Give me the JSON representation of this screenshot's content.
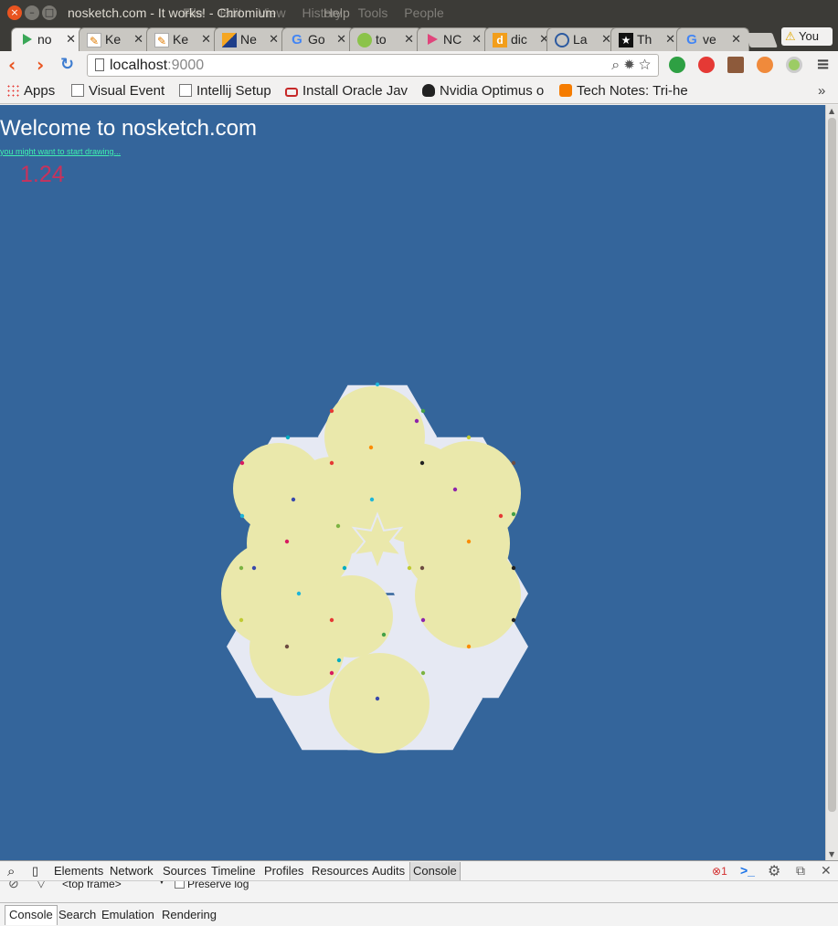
{
  "window": {
    "title": "nosketch.com - It works! - Chromium",
    "menus": [
      "File",
      "Edit",
      "View",
      "History",
      "Tools",
      "People"
    ],
    "help_menu": "Help"
  },
  "tabs": [
    {
      "label": "no",
      "icon": "play-icon",
      "active": true
    },
    {
      "label": "Ke",
      "icon": "pencil-icon"
    },
    {
      "label": "Ke",
      "icon": "pencil-icon"
    },
    {
      "label": "Ne",
      "icon": "flag-icon"
    },
    {
      "label": "Go",
      "icon": "google-icon"
    },
    {
      "label": "to",
      "icon": "android-icon"
    },
    {
      "label": "NC",
      "icon": "play-store-icon"
    },
    {
      "label": "dic",
      "icon": "dict-icon"
    },
    {
      "label": "La",
      "icon": "globe-icon"
    },
    {
      "label": "Th",
      "icon": "star-icon"
    },
    {
      "label": "ve",
      "icon": "google-icon"
    }
  ],
  "profile_label": "You",
  "omnibox": {
    "host": "localhost",
    "port": ":9000"
  },
  "bookmarks": [
    {
      "label": "Apps",
      "icon": "apps-grid-icon"
    },
    {
      "label": "Visual Event",
      "icon": "page-icon"
    },
    {
      "label": "Intellij Setup",
      "icon": "page-icon"
    },
    {
      "label": "Install Oracle Jav",
      "icon": "glasses-icon"
    },
    {
      "label": "Nvidia Optimus o",
      "icon": "tux-icon"
    },
    {
      "label": "Tech Notes: Tri-he",
      "icon": "blogger-icon"
    }
  ],
  "page": {
    "heading": "Welcome to nosketch.com",
    "hint": "you might want to start drawing...",
    "fps": "1.24",
    "colors": {
      "background": "#34659b",
      "hexagon": "#e6e9f3",
      "circle": "#eae8ab"
    }
  },
  "devtools": {
    "tabs": [
      "Elements",
      "Network",
      "Sources",
      "Timeline",
      "Profiles",
      "Resources",
      "Audits",
      "Console"
    ],
    "active_tab": "Console",
    "error_count": "1",
    "frame_select": "<top frame>",
    "preserve_log": "Preserve log",
    "drawer_tabs": [
      "Console",
      "Search",
      "Emulation",
      "Rendering"
    ]
  }
}
